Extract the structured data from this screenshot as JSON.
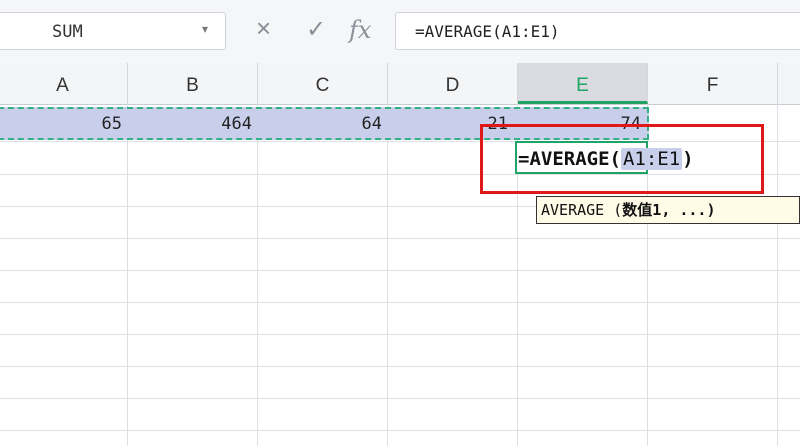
{
  "formula_bar": {
    "name_box": "SUM",
    "cancel_glyph": "×",
    "confirm_glyph": "✓",
    "fx_label": "fx",
    "formula": "=AVERAGE(A1:E1)"
  },
  "columns": [
    "A",
    "B",
    "C",
    "D",
    "E",
    "F"
  ],
  "active_column": "E",
  "row1": {
    "A": "65",
    "B": "464",
    "C": "64",
    "D": "21",
    "E": "74"
  },
  "editing_cell": {
    "prefix": "=AVERAGE(",
    "range_ref": "A1:E1",
    "suffix": ")"
  },
  "tooltip": {
    "func": "AVERAGE",
    "open": " (",
    "arg": "数值1",
    "rest": ", ...)"
  },
  "colors": {
    "accent_green": "#21a366",
    "selection_fill": "#c9cfeb",
    "highlight_red": "#e01818"
  }
}
